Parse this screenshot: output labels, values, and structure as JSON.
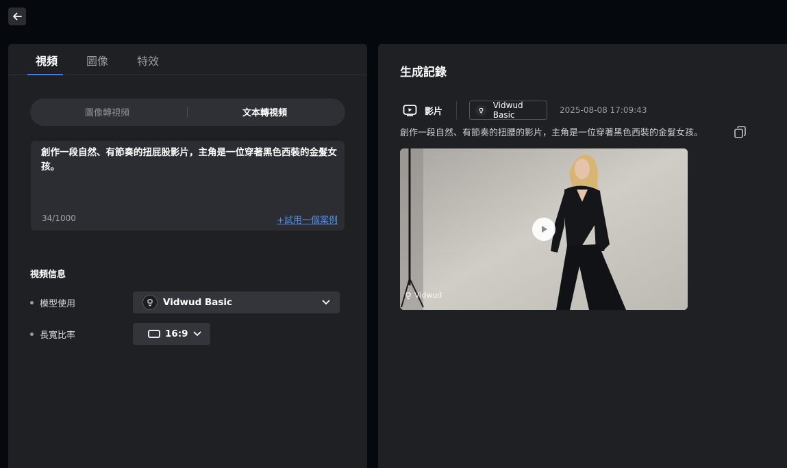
{
  "tabs": [
    {
      "label": "視頻",
      "active": true
    },
    {
      "label": "圖像",
      "active": false
    },
    {
      "label": "特效",
      "active": false
    }
  ],
  "mode": {
    "image_to_video": "圖像轉視頻",
    "text_to_video": "文本轉視頻",
    "active": "text_to_video"
  },
  "prompt": {
    "text": "創作一段自然、有節奏的扭屁股影片，主角是一位穿著黑色西裝的金髮女孩。",
    "count": "34/1000",
    "try_example": "+試用一個案例"
  },
  "video_info": {
    "title": "視頻信息",
    "model_label": "模型使用",
    "model_value": "Vidwud Basic",
    "ratio_label": "長寬比率",
    "ratio_value": "16:9"
  },
  "history": {
    "title": "生成記錄",
    "record": {
      "type": "影片",
      "model": "Vidwud Basic",
      "timestamp": "2025-08-08 17:09:43",
      "prompt": "創作一段自然、有節奏的扭腰的影片，主角是一位穿著黑色西裝的金髮女孩。",
      "watermark": "Vidwud"
    }
  },
  "colors": {
    "accent": "#3f7ee8",
    "link": "#4f8fe6",
    "panel": "#1f2024",
    "background": "#05080c"
  },
  "icons": {
    "back": "arrow-left-icon",
    "chevron": "chevron-down-icon",
    "video": "video-icon",
    "copy": "copy-icon",
    "play": "play-icon"
  }
}
